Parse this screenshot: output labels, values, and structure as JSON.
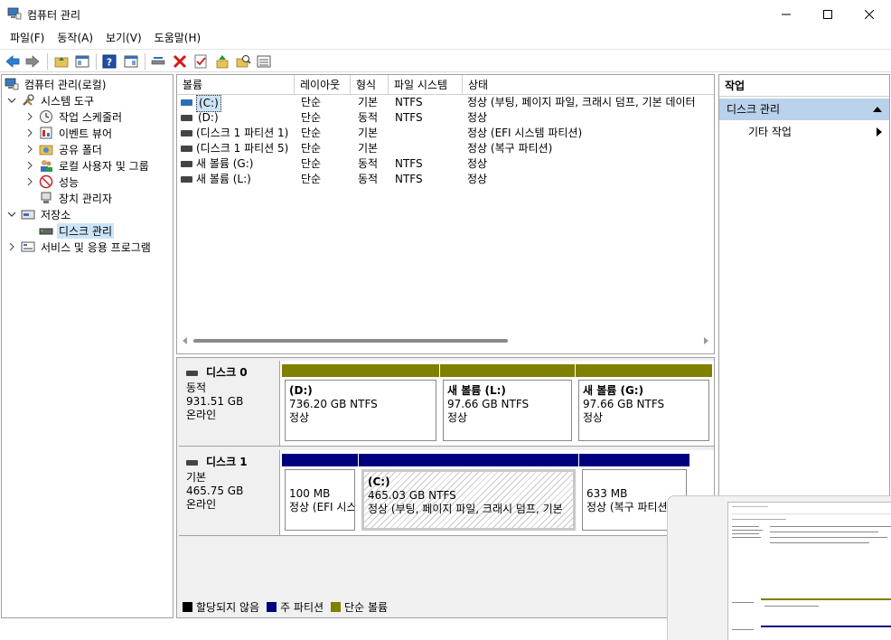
{
  "window": {
    "title": "컴퓨터 관리"
  },
  "menu": {
    "items": [
      "파일(F)",
      "동작(A)",
      "보기(V)",
      "도움말(H)"
    ]
  },
  "tree": {
    "root": "컴퓨터 관리(로컬)",
    "system_tools": "시스템 도구",
    "task_scheduler": "작업 스케줄러",
    "event_viewer": "이벤트 뷰어",
    "shared_folders": "공유 폴더",
    "local_users": "로컬 사용자 및 그룹",
    "performance": "성능",
    "device_manager": "장치 관리자",
    "storage": "저장소",
    "disk_management": "디스크 관리",
    "services": "서비스 및 응용 프로그램"
  },
  "volumes": {
    "columns": [
      "볼륨",
      "레이아웃",
      "형식",
      "파일 시스템",
      "상태"
    ],
    "rows": [
      {
        "name": "(C:)",
        "layout": "단순",
        "type": "기본",
        "fs": "NTFS",
        "status": "정상 (부팅, 페이지 파일, 크래시 덤프, 기본 데이터"
      },
      {
        "name": "(D:)",
        "layout": "단순",
        "type": "동적",
        "fs": "NTFS",
        "status": "정상"
      },
      {
        "name": "(디스크 1 파티션 1)",
        "layout": "단순",
        "type": "기본",
        "fs": "",
        "status": "정상 (EFI 시스템 파티션)"
      },
      {
        "name": "(디스크 1 파티션 5)",
        "layout": "단순",
        "type": "기본",
        "fs": "",
        "status": "정상 (복구 파티션)"
      },
      {
        "name": "새 볼륨 (G:)",
        "layout": "단순",
        "type": "동적",
        "fs": "NTFS",
        "status": "정상"
      },
      {
        "name": "새 볼륨 (L:)",
        "layout": "단순",
        "type": "동적",
        "fs": "NTFS",
        "status": "정상"
      }
    ]
  },
  "disks": [
    {
      "name": "디스크 0",
      "type": "동적",
      "size": "931.51 GB",
      "state": "온라인",
      "partitions": [
        {
          "name": "(D:)",
          "size": "736.20 GB NTFS",
          "status": "정상"
        },
        {
          "name": "새 볼륨  (L:)",
          "size": "97.66 GB NTFS",
          "status": "정상"
        },
        {
          "name": "새 볼륨  (G:)",
          "size": "97.66 GB NTFS",
          "status": "정상"
        }
      ]
    },
    {
      "name": "디스크 1",
      "type": "기본",
      "size": "465.75 GB",
      "state": "온라인",
      "partitions": [
        {
          "name": "",
          "size": "100 MB",
          "status": "정상 (EFI 시스"
        },
        {
          "name": "(C:)",
          "size": "465.03 GB NTFS",
          "status": "정상 (부팅, 페이지 파일, 크래시 덤프, 기본"
        },
        {
          "name": "",
          "size": "633 MB",
          "status": "정상 (복구 파티션)"
        }
      ]
    }
  ],
  "legend": {
    "unallocated": "할당되지 않음",
    "primary": "주 파티션",
    "simple": "단순 볼륨"
  },
  "actions": {
    "header": "작업",
    "section": "디스크 관리",
    "more": "기타 작업"
  },
  "colors": {
    "primary_partition": "#00007f",
    "simple_volume": "#7f7f00",
    "unallocated": "#000000",
    "selection": "#cce4f7",
    "action_section": "#b9d1ea"
  }
}
